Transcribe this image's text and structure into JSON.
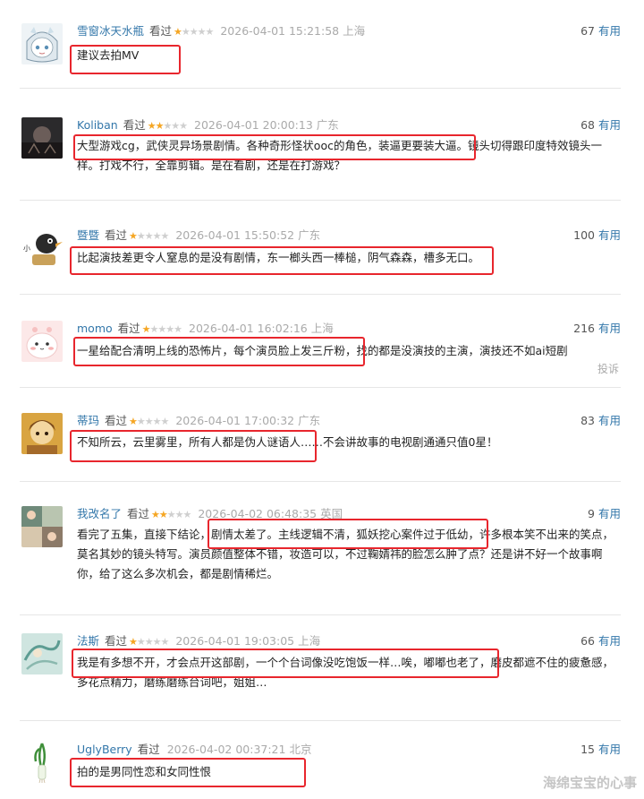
{
  "useful_label": "有用",
  "watched_label": "看过",
  "report_label": "投诉",
  "watermark": "海绵宝宝的心事",
  "colors": {
    "highlight": "#e8262d",
    "username": "#3377aa",
    "star": "#f5a623"
  },
  "comments": [
    {
      "user": "雪窗冰天水瓶",
      "rating": 1,
      "time": "2026-04-01 15:21:58",
      "location": "上海",
      "votes": "67",
      "text": "建议去拍MV",
      "avatar_icon": "anime-character-avatar"
    },
    {
      "user": "Koliban",
      "rating": 2,
      "time": "2026-04-01 20:00:13",
      "location": "广东",
      "votes": "68",
      "text": "大型游戏cg，武侠灵异场景剧情。各种奇形怪状ooc的角色，装逼更要装大逼。镜头切得跟印度特效镜头一样。打戏不行，全靠剪辑。是在看剧，还是在打游戏？",
      "avatar_icon": "dark-landscape-avatar"
    },
    {
      "user": "暨暨",
      "rating": 1,
      "time": "2026-04-01 15:50:52",
      "location": "广东",
      "votes": "100",
      "text": "比起演技差更令人窒息的是没有剧情，东一榔头西一棒槌，阴气森森，槽多无口。",
      "avatar_icon": "cartoon-bird-avatar"
    },
    {
      "user": "momo",
      "rating": 1,
      "time": "2026-04-01 16:02:16",
      "location": "上海",
      "votes": "216",
      "text": "一星给配合清明上线的恐怖片，每个演员脸上发三斤粉，找的都是没演技的主演，演技还不如ai短剧",
      "avatar_icon": "cute-face-avatar"
    },
    {
      "user": "蒂玛",
      "rating": 1,
      "time": "2026-04-01 17:00:32",
      "location": "广东",
      "votes": "83",
      "text": "不知所云，云里雾里，所有人都是伪人谜语人……不会讲故事的电视剧通通只值0星！",
      "avatar_icon": "golden-portrait-avatar"
    },
    {
      "user": "我改名了",
      "rating": 2,
      "time": "2026-04-02 06:48:35",
      "location": "英国",
      "votes": "9",
      "text": "看完了五集，直接下结论，剧情太差了。主线逻辑不清，狐妖挖心案件过于低幼，许多根本笑不出来的笑点，莫名其妙的镜头特写。演员颜值整体不错，妆造可以，不过鞠婧祎的脸怎么肿了点？还是讲不好一个故事啊你，给了这么多次机会，都是剧情稀烂。",
      "avatar_icon": "photo-collage-avatar"
    },
    {
      "user": "法斯",
      "rating": 1,
      "time": "2026-04-01 19:03:05",
      "location": "上海",
      "votes": "66",
      "text": "我是有多想不开，才会点开这部剧，一个个台词像没吃饱饭一样…唉，嘟嘟也老了，磨皮都遮不住的疲惫感，多花点精力，磨练磨练台词吧，姐姐…",
      "avatar_icon": "teal-art-avatar"
    },
    {
      "user": "UglyBerry",
      "rating": 0,
      "time": "2026-04-02 00:37:21",
      "location": "北京",
      "votes": "15",
      "text": "拍的是男同性恋和女同性恨",
      "avatar_icon": "leek-avatar"
    }
  ]
}
